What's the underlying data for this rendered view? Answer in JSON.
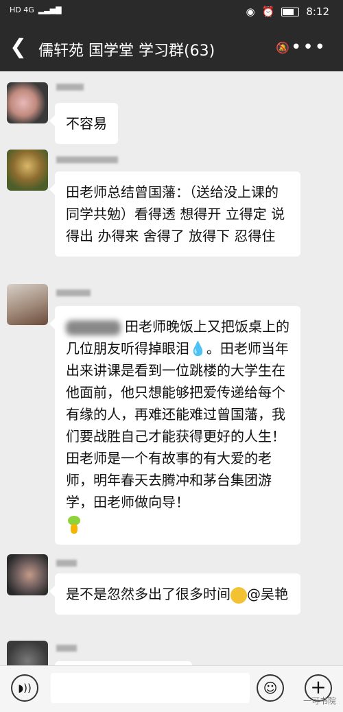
{
  "status_bar": {
    "network": "HD 4G",
    "icons": [
      "eye-icon",
      "alarm-icon",
      "battery-icon"
    ],
    "time": "8:12"
  },
  "header": {
    "back_icon": "back-arrow-icon",
    "title": "儒轩苑 国学堂 学习群(63)",
    "mute_icon": "mute-bell-icon",
    "more_icon": "more-dots-icon"
  },
  "messages": [
    {
      "text": "不容易"
    },
    {
      "text": "田老师总结曾国藩：（送给没上课的同学共勉）看得透 想得开 立得定 说得出 办得来 舍得了 放得下 忍得住"
    },
    {
      "text_a": "田老师晚饭上又把饭桌上的几位朋友听得掉眼泪",
      "emoji_drop": "💧",
      "text_b": "。田老师当年出来讲课是看到一位跳楼的大学生在他面前，他只想能够把爱传递给每个有缘的人，再难还能难过曾国藩，我们要战胜自己才能获得更好的人生！田老师是一个有故事的有大爱的老师，明年春天去腾冲和茅台集团游学，田老师做向导！"
    },
    {
      "text_a": "是不是忽然多出了很多时间",
      "text_b": "@吴艳"
    }
  ],
  "input_bar": {
    "voice_icon": "voice-icon",
    "emoji_icon": "emoji-icon",
    "plus_icon": "plus-icon"
  },
  "watermark": "一可书院",
  "colors": {
    "header_bg": "#2a2a2a",
    "chat_bg": "#ededed",
    "bubble_bg": "#ffffff"
  }
}
